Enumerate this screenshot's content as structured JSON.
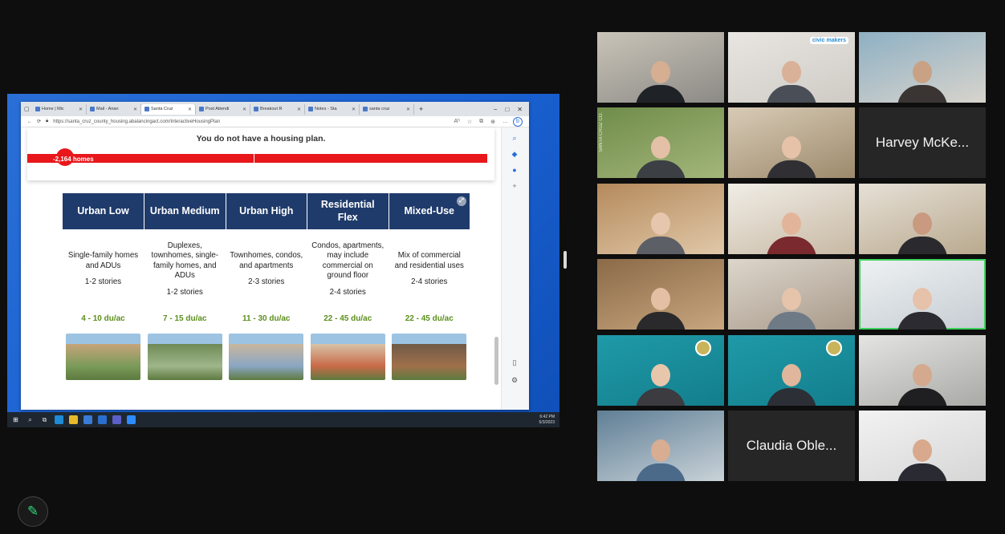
{
  "browser": {
    "tabs": [
      {
        "label": "Home | Mic",
        "active": false
      },
      {
        "label": "Mail - Anan",
        "active": false
      },
      {
        "label": "Santa Cruz",
        "active": true
      },
      {
        "label": "Post Attendi",
        "active": false
      },
      {
        "label": "Breakout R",
        "active": false
      },
      {
        "label": "Notes - Sta",
        "active": false
      },
      {
        "label": "santa cruz",
        "active": false
      }
    ],
    "new_tab": "+",
    "controls": {
      "minimize": "−",
      "restore": "□",
      "close": "✕"
    },
    "url": "https://santa_cruz_county_housing.abalancingact.com/InteractiveHousingPlan",
    "tool_icons": [
      "Aʰ",
      "☆",
      "⧉",
      "⊕",
      "…"
    ]
  },
  "housing_plan": {
    "title": "You do not have a housing plan.",
    "homes_label": "-2,164 homes"
  },
  "zones": [
    {
      "name": "Urban Low",
      "description": "Single-family homes and ADUs",
      "stories": "1-2 stories",
      "density": "4 - 10 du/ac",
      "img": [
        "#7a9b5a",
        "#c7a47a"
      ]
    },
    {
      "name": "Urban Medium",
      "description": "Duplexes, townhomes, single-family homes, and ADUs",
      "stories": "1-2 stories",
      "density": "7 - 15 du/ac",
      "img": [
        "#9fb58b",
        "#6e8a55"
      ]
    },
    {
      "name": "Urban High",
      "description": "Townhomes, condos, and apartments",
      "stories": "2-3 stories",
      "density": "11 - 30 du/ac",
      "img": [
        "#8aa6c4",
        "#c9b79d"
      ]
    },
    {
      "name": "Residential Flex",
      "description": "Condos, apartments, may include commercial on ground floor",
      "stories": "2-4 stories",
      "density": "22 - 45 du/ac",
      "img": [
        "#c96a48",
        "#d8c4a8"
      ]
    },
    {
      "name": "Mixed-Use",
      "description": "Mix of commercial and residential uses",
      "stories": "2-4 stories",
      "density": "22 - 45 du/ac",
      "img": [
        "#a0704a",
        "#6f5a48"
      ]
    }
  ],
  "taskbar": {
    "time": "6:42 PM",
    "date": "5/3/2023"
  },
  "colors": {
    "header_bg": "#1f3b6b",
    "density_green": "#5a8f1b",
    "bar_red": "#e8171b",
    "speaking_border": "#3bd15b"
  },
  "participants": [
    {
      "row": 0,
      "col": 0,
      "type": "video",
      "bg": [
        "#c9c4b8",
        "#8c8a86"
      ],
      "skin": "#d6ae92",
      "shirt": "#1f2226"
    },
    {
      "row": 0,
      "col": 1,
      "type": "video",
      "bg": [
        "#e8e6e2",
        "#cfcac4"
      ],
      "skin": "#d9b199",
      "shirt": "#4a4e57",
      "logo": "civic makers"
    },
    {
      "row": 0,
      "col": 2,
      "type": "video",
      "bg": [
        "#8eb0c4",
        "#d8d4cc"
      ],
      "skin": "#c9a184",
      "shirt": "#3a3532"
    },
    {
      "row": 1,
      "col": 0,
      "type": "video",
      "bg": [
        "#6f8c4a",
        "#a3b67a"
      ],
      "skin": "#e3c0a6",
      "shirt": "#3c3f44",
      "side_text": "SANTA CRUZ CO."
    },
    {
      "row": 1,
      "col": 1,
      "type": "video",
      "bg": [
        "#d8cbb6",
        "#9d8a6c"
      ],
      "skin": "#e6c3a8",
      "shirt": "#2f2f34"
    },
    {
      "row": 1,
      "col": 2,
      "type": "name",
      "name": "Harvey McKe..."
    },
    {
      "row": 2,
      "col": 0,
      "type": "video",
      "bg": [
        "#b58a5c",
        "#e0c8a8"
      ],
      "skin": "#e7c6ae",
      "shirt": "#5c5f66"
    },
    {
      "row": 2,
      "col": 1,
      "type": "video",
      "bg": [
        "#f0ede6",
        "#c8b9a4"
      ],
      "skin": "#e2b59b",
      "shirt": "#7a2a2e"
    },
    {
      "row": 2,
      "col": 2,
      "type": "video",
      "bg": [
        "#e6e0d6",
        "#b9a98e"
      ],
      "skin": "#c99a80",
      "shirt": "#2a2a2e"
    },
    {
      "row": 3,
      "col": 0,
      "type": "video",
      "bg": [
        "#8a6a48",
        "#c8a67e"
      ],
      "skin": "#e4bfa3",
      "shirt": "#2a2a2c"
    },
    {
      "row": 3,
      "col": 1,
      "type": "video",
      "bg": [
        "#ddd6cc",
        "#a89a8a"
      ],
      "skin": "#e6c4ac",
      "shirt": "#6e7a86"
    },
    {
      "row": 3,
      "col": 2,
      "type": "video",
      "bg": [
        "#eef2f4",
        "#c6ccd2"
      ],
      "skin": "#e6c2aa",
      "shirt": "#2b2b31",
      "speaking": true
    },
    {
      "row": 4,
      "col": 0,
      "type": "video",
      "bg": [
        "#1f9aa8",
        "#137e8c"
      ],
      "skin": "#e8c6ac",
      "shirt": "#3b3b40",
      "seal": true
    },
    {
      "row": 4,
      "col": 1,
      "type": "video",
      "bg": [
        "#1f9aa8",
        "#137e8c"
      ],
      "skin": "#e0b79c",
      "shirt": "#2c2f36",
      "seal": true
    },
    {
      "row": 4,
      "col": 2,
      "type": "video",
      "bg": [
        "#e4e4e2",
        "#a9a9a6"
      ],
      "skin": "#d4a98e",
      "shirt": "#1f1f22"
    },
    {
      "row": 5,
      "col": 0,
      "type": "video",
      "bg": [
        "#5f7f96",
        "#c9d2d8"
      ],
      "skin": "#d9ad92",
      "shirt": "#4b6a8a"
    },
    {
      "row": 5,
      "col": 1,
      "type": "name",
      "name": "Claudia Oble..."
    },
    {
      "row": 5,
      "col": 2,
      "type": "video",
      "bg": [
        "#f2f2f2",
        "#d6d6d6"
      ],
      "skin": "#d8a98c",
      "shirt": "#2a2a33"
    }
  ],
  "icons": {
    "annotate": "pen-icon"
  }
}
